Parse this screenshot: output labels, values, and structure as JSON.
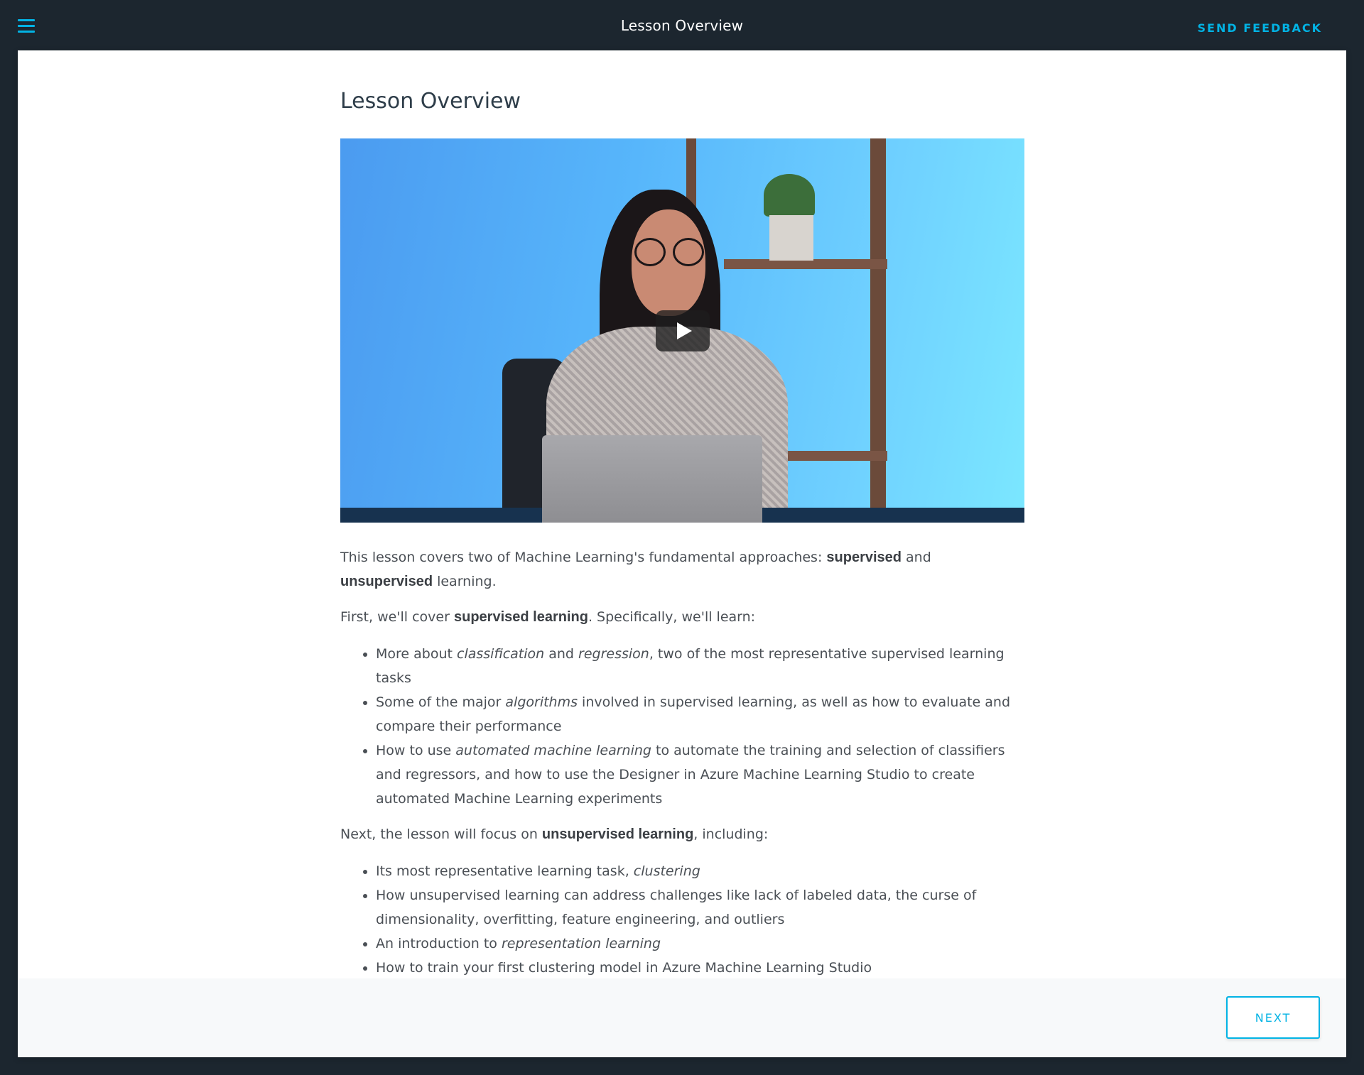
{
  "topbar": {
    "title": "Lesson Overview",
    "feedback_label": "SEND FEEDBACK",
    "menu_icon": "hamburger-menu-icon"
  },
  "main": {
    "title": "Lesson Overview",
    "video": {
      "play_icon": "play-icon"
    },
    "intro": {
      "t1": "This lesson covers two of Machine Learning's fundamental approaches: ",
      "b1": "supervised",
      "t2": " and ",
      "b2": "unsupervised",
      "t3": " learning."
    },
    "supervised_intro": {
      "t1": "First, we'll cover ",
      "b1": "supervised learning",
      "t2": ". Specifically, we'll learn:"
    },
    "supervised_items": [
      {
        "t1": "More about ",
        "i1": "classification",
        "t2": " and ",
        "i2": "regression",
        "t3": ", two of the most representative supervised learning tasks"
      },
      {
        "t1": "Some of the major ",
        "i1": "algorithms",
        "t2": " involved in supervised learning, as well as how to evaluate and compare their performance"
      },
      {
        "t1": "How to use ",
        "i1": "automated machine learning",
        "t2": " to automate the training and selection of classifiers and regressors, and how to use the Designer in Azure Machine Learning Studio to create automated Machine Learning experiments"
      }
    ],
    "unsupervised_intro": {
      "t1": "Next, the lesson will focus on ",
      "b1": "unsupervised learning",
      "t2": ", including:"
    },
    "unsupervised_items": [
      {
        "t1": "Its most representative learning task, ",
        "i1": "clustering"
      },
      {
        "t1": "How unsupervised learning can address challenges like lack of labeled data, the curse of dimensionality, overfitting, feature engineering, and outliers"
      },
      {
        "t1": "An introduction to ",
        "i1": "representation learning"
      },
      {
        "t1": "How to train your first clustering model in Azure Machine Learning Studio"
      }
    ]
  },
  "footer": {
    "next_label": "NEXT"
  },
  "colors": {
    "accent": "#02b3e4",
    "topbar": "#1c262f",
    "title": "#2e3d49"
  }
}
